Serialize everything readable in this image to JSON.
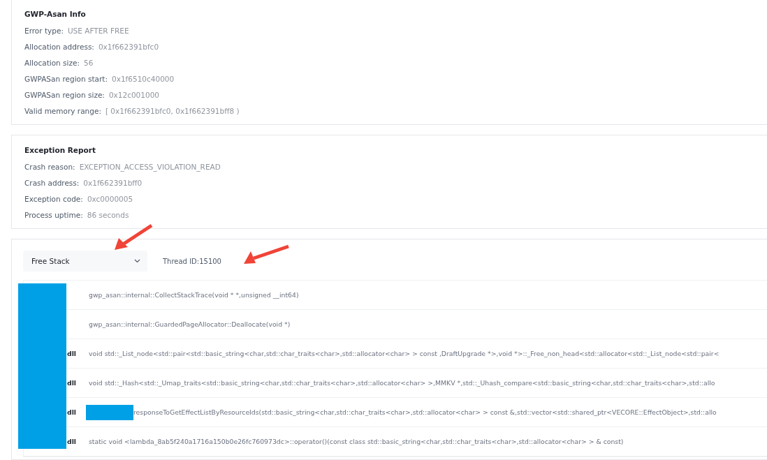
{
  "sections": [
    {
      "title": "GWP-Asan Info",
      "fields": [
        {
          "label": "Error type:",
          "value": "USE AFTER FREE"
        },
        {
          "label": "Allocation address:",
          "value": "0x1f662391bfc0"
        },
        {
          "label": "Allocation size:",
          "value": "56"
        },
        {
          "label": "GWPASan region start:",
          "value": "0x1f6510c40000"
        },
        {
          "label": "GWPASan region size:",
          "value": "0x12c001000"
        },
        {
          "label": "Valid memory range:",
          "value": "[ 0x1f662391bfc0, 0x1f662391bff8 )"
        }
      ]
    },
    {
      "title": "Exception Report",
      "fields": [
        {
          "label": "Crash reason:",
          "value": "EXCEPTION_ACCESS_VIOLATION_READ"
        },
        {
          "label": "Crash address:",
          "value": "0x1f662391bff0"
        },
        {
          "label": "Exception code:",
          "value": "0xc0000005"
        },
        {
          "label": "Process uptime:",
          "value": "86 seconds"
        }
      ]
    }
  ],
  "stack": {
    "selector": {
      "value": "Free Stack"
    },
    "thread": "Thread ID:15100",
    "frames": [
      {
        "function": "gwp_asan::internal::CollectStackTrace(void * *,unsigned __int64)"
      },
      {
        "function": "gwp_asan::internal::GuardedPageAllocator::Deallocate(void *)"
      },
      {
        "module": "dll",
        "function": "void std::_List_node<std::pair<std::basic_string<char,std::char_traits<char>,std::allocator<char> > const ,DraftUpgrade *>,void *>::_Free_non_head<std::allocator<std::_List_node<std::pair<"
      },
      {
        "module": "dll",
        "function": "void std::_Hash<std::_Umap_traits<std::basic_string<char,std::char_traits<char>,std::allocator<char> >,MMKV *,std::_Uhash_compare<std::basic_string<char,std::char_traits<char>,std::allo"
      },
      {
        "module": "dll",
        "redacted_prefix": true,
        "function": "responseToGetEffectListByResourceIds(std::basic_string<char,std::char_traits<char>,std::allocator<char> > const &,std::vector<std::shared_ptr<VECORE::EffectObject>,std::allo"
      },
      {
        "module": "dll",
        "function": "static void <lambda_8ab5f240a1716a150b0e26fc760973dc>::operator()(const class std::basic_string<char,std::char_traits<char>,std::allocator<char> > & const)"
      }
    ]
  }
}
